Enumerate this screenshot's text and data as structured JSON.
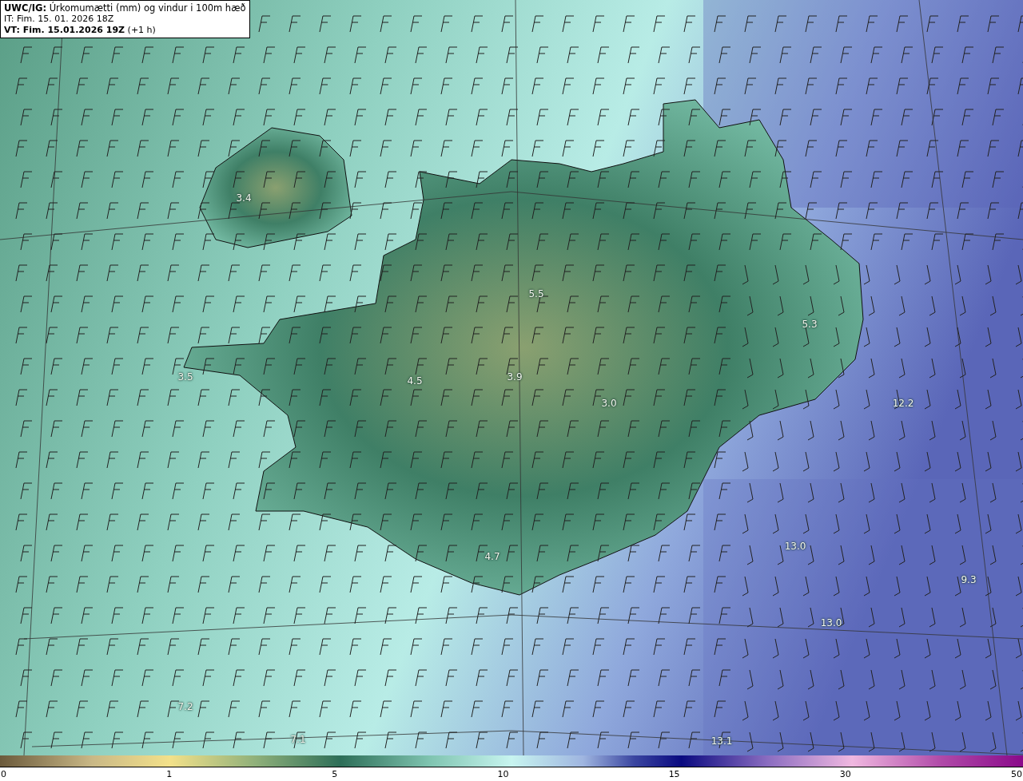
{
  "title_box": {
    "headline": "**UWC/IG:** Úrkomumætti (mm) og vindur i 100m hæð",
    "initial_time": "IT: Fim. 15. 01. 2026 18Z",
    "valid_time": "**VT: Fim. 15.01.2026 19Z** (+1 h)"
  },
  "map_labels": [
    "3.4",
    "5.5",
    "5.3",
    "3.5",
    "3.9",
    "4.5",
    "12.2",
    "3.0",
    "13.0",
    "4.7",
    "9.3",
    "13.0",
    "7.2",
    "7.1",
    "13.1"
  ],
  "colorbar": {
    "ticks": [
      "0",
      "1",
      "5",
      "10",
      "15",
      "30",
      "50"
    ]
  }
}
